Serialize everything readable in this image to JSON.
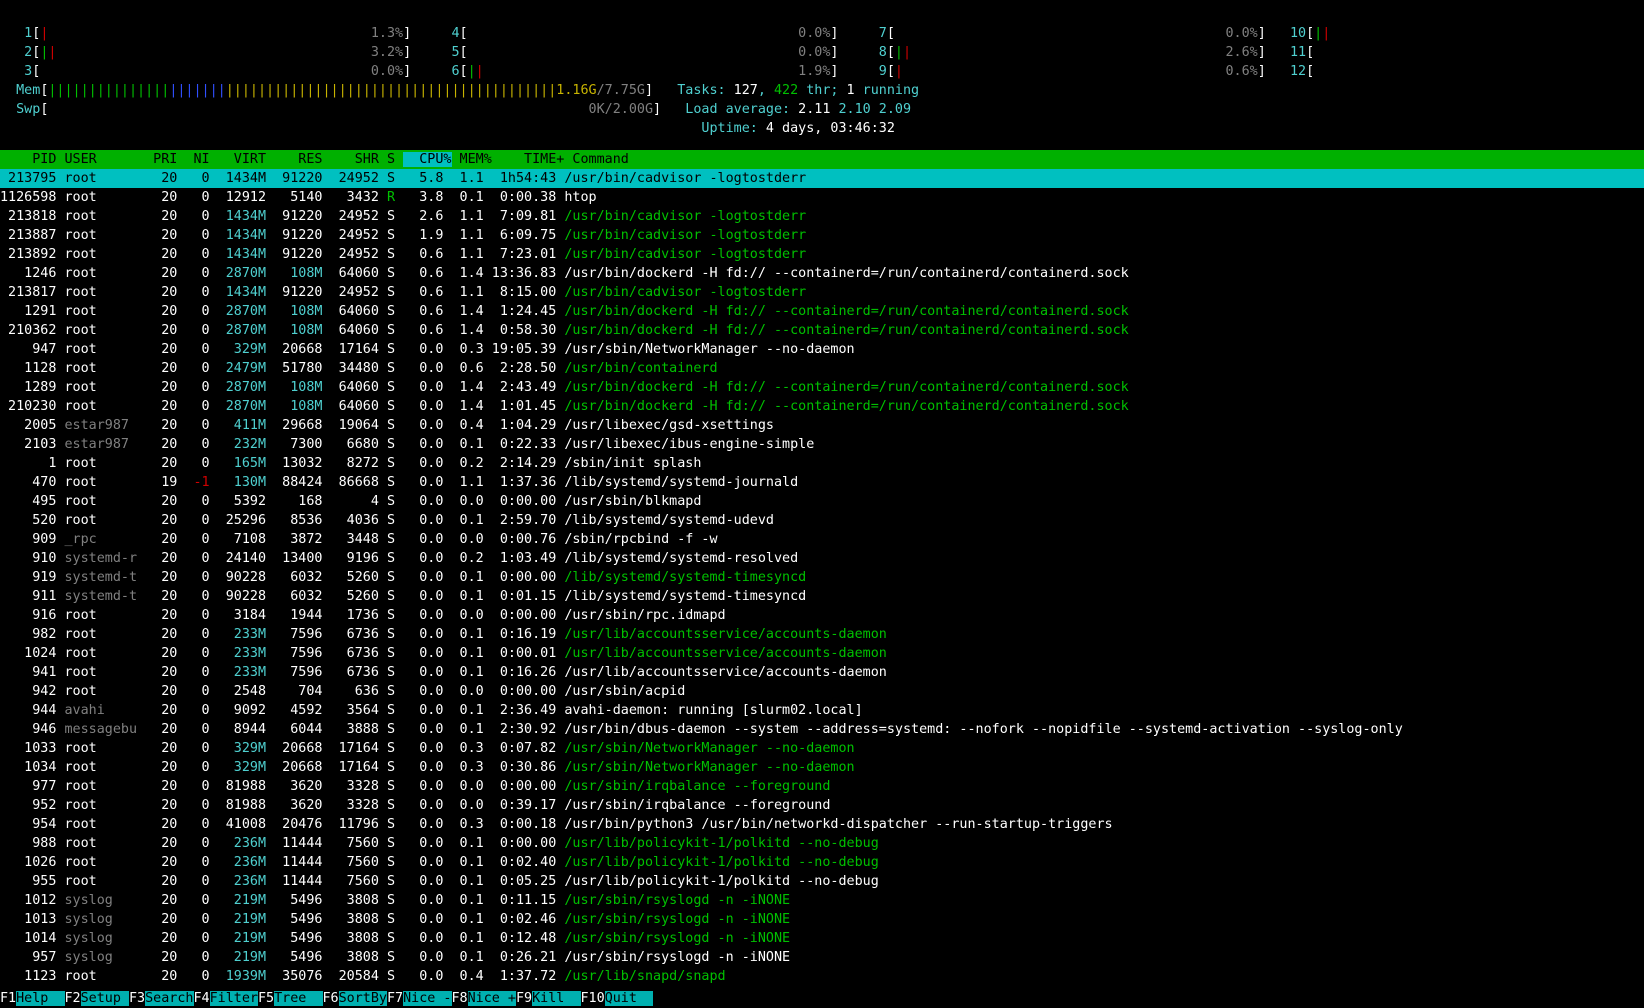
{
  "cpus": [
    {
      "id": "1",
      "pct": "1.3%"
    },
    {
      "id": "2",
      "pct": "3.2%"
    },
    {
      "id": "3",
      "pct": "0.0%"
    },
    {
      "id": "4",
      "pct": "0.0%"
    },
    {
      "id": "5",
      "pct": "0.0%"
    },
    {
      "id": "6",
      "pct": "1.9%"
    },
    {
      "id": "7",
      "pct": "0.0%"
    },
    {
      "id": "8",
      "pct": "2.6%"
    },
    {
      "id": "9",
      "pct": "0.6%"
    },
    {
      "id": "10",
      "pct": ""
    },
    {
      "id": "11",
      "pct": ""
    },
    {
      "id": "12",
      "pct": ""
    }
  ],
  "mem": {
    "label": "Mem",
    "used": "1.16G",
    "total": "7.75G"
  },
  "swp": {
    "label": "Swp",
    "used": "0K",
    "total": "2.00G"
  },
  "tasks": {
    "label": "Tasks:",
    "count": "127",
    "thr": "422",
    "thr_label": "thr;",
    "running": "1",
    "running_label": "running"
  },
  "load": {
    "label": "Load average:",
    "v1": "2.11",
    "v2": "2.10",
    "v3": "2.09"
  },
  "uptime": {
    "label": "Uptime:",
    "value": "4 days, 03:46:32"
  },
  "columns": [
    "PID",
    "USER",
    "PRI",
    "NI",
    "VIRT",
    "RES",
    "SHR",
    "S",
    "CPU%",
    "MEM%",
    "TIME+",
    "Command"
  ],
  "sorted_column": "CPU%",
  "processes": [
    {
      "pid": "213795",
      "user": "root",
      "pri": "20",
      "ni": "0",
      "virt": "1434M",
      "res": "91220",
      "shr": "24952",
      "s": "S",
      "cpu": "5.8",
      "mem": "1.1",
      "time": "1h54:43",
      "cmd": "/usr/bin/cadvisor -logtostderr",
      "thread": false,
      "selected": true
    },
    {
      "pid": "1126598",
      "user": "root",
      "pri": "20",
      "ni": "0",
      "virt": "12912",
      "res": "5140",
      "shr": "3432",
      "s": "R",
      "cpu": "3.8",
      "mem": "0.1",
      "time": "0:00.38",
      "cmd": "htop",
      "thread": false
    },
    {
      "pid": "213818",
      "user": "root",
      "pri": "20",
      "ni": "0",
      "virt": "1434M",
      "res": "91220",
      "shr": "24952",
      "s": "S",
      "cpu": "2.6",
      "mem": "1.1",
      "time": "7:09.81",
      "cmd": "/usr/bin/cadvisor -logtostderr",
      "thread": true
    },
    {
      "pid": "213887",
      "user": "root",
      "pri": "20",
      "ni": "0",
      "virt": "1434M",
      "res": "91220",
      "shr": "24952",
      "s": "S",
      "cpu": "1.9",
      "mem": "1.1",
      "time": "6:09.75",
      "cmd": "/usr/bin/cadvisor -logtostderr",
      "thread": true
    },
    {
      "pid": "213892",
      "user": "root",
      "pri": "20",
      "ni": "0",
      "virt": "1434M",
      "res": "91220",
      "shr": "24952",
      "s": "S",
      "cpu": "0.6",
      "mem": "1.1",
      "time": "7:23.01",
      "cmd": "/usr/bin/cadvisor -logtostderr",
      "thread": true
    },
    {
      "pid": "1246",
      "user": "root",
      "pri": "20",
      "ni": "0",
      "virt": "2870M",
      "res": "108M",
      "shr": "64060",
      "s": "S",
      "cpu": "0.6",
      "mem": "1.4",
      "time": "13:36.83",
      "cmd": "/usr/bin/dockerd -H fd:// --containerd=/run/containerd/containerd.sock",
      "thread": false
    },
    {
      "pid": "213817",
      "user": "root",
      "pri": "20",
      "ni": "0",
      "virt": "1434M",
      "res": "91220",
      "shr": "24952",
      "s": "S",
      "cpu": "0.6",
      "mem": "1.1",
      "time": "8:15.00",
      "cmd": "/usr/bin/cadvisor -logtostderr",
      "thread": true
    },
    {
      "pid": "1291",
      "user": "root",
      "pri": "20",
      "ni": "0",
      "virt": "2870M",
      "res": "108M",
      "shr": "64060",
      "s": "S",
      "cpu": "0.6",
      "mem": "1.4",
      "time": "1:24.45",
      "cmd": "/usr/bin/dockerd -H fd:// --containerd=/run/containerd/containerd.sock",
      "thread": true
    },
    {
      "pid": "210362",
      "user": "root",
      "pri": "20",
      "ni": "0",
      "virt": "2870M",
      "res": "108M",
      "shr": "64060",
      "s": "S",
      "cpu": "0.6",
      "mem": "1.4",
      "time": "0:58.30",
      "cmd": "/usr/bin/dockerd -H fd:// --containerd=/run/containerd/containerd.sock",
      "thread": true
    },
    {
      "pid": "947",
      "user": "root",
      "pri": "20",
      "ni": "0",
      "virt": "329M",
      "res": "20668",
      "shr": "17164",
      "s": "S",
      "cpu": "0.0",
      "mem": "0.3",
      "time": "19:05.39",
      "cmd": "/usr/sbin/NetworkManager --no-daemon",
      "thread": false
    },
    {
      "pid": "1128",
      "user": "root",
      "pri": "20",
      "ni": "0",
      "virt": "2479M",
      "res": "51780",
      "shr": "34480",
      "s": "S",
      "cpu": "0.0",
      "mem": "0.6",
      "time": "2:28.50",
      "cmd": "/usr/bin/containerd",
      "thread": true
    },
    {
      "pid": "1289",
      "user": "root",
      "pri": "20",
      "ni": "0",
      "virt": "2870M",
      "res": "108M",
      "shr": "64060",
      "s": "S",
      "cpu": "0.0",
      "mem": "1.4",
      "time": "2:43.49",
      "cmd": "/usr/bin/dockerd -H fd:// --containerd=/run/containerd/containerd.sock",
      "thread": true
    },
    {
      "pid": "210230",
      "user": "root",
      "pri": "20",
      "ni": "0",
      "virt": "2870M",
      "res": "108M",
      "shr": "64060",
      "s": "S",
      "cpu": "0.0",
      "mem": "1.4",
      "time": "1:01.45",
      "cmd": "/usr/bin/dockerd -H fd:// --containerd=/run/containerd/containerd.sock",
      "thread": true
    },
    {
      "pid": "2005",
      "user": "estar987",
      "pri": "20",
      "ni": "0",
      "virt": "411M",
      "res": "29668",
      "shr": "19064",
      "s": "S",
      "cpu": "0.0",
      "mem": "0.4",
      "time": "1:04.29",
      "cmd": "/usr/libexec/gsd-xsettings",
      "thread": false
    },
    {
      "pid": "2103",
      "user": "estar987",
      "pri": "20",
      "ni": "0",
      "virt": "232M",
      "res": "7300",
      "shr": "6680",
      "s": "S",
      "cpu": "0.0",
      "mem": "0.1",
      "time": "0:22.33",
      "cmd": "/usr/libexec/ibus-engine-simple",
      "thread": false
    },
    {
      "pid": "1",
      "user": "root",
      "pri": "20",
      "ni": "0",
      "virt": "165M",
      "res": "13032",
      "shr": "8272",
      "s": "S",
      "cpu": "0.0",
      "mem": "0.2",
      "time": "2:14.29",
      "cmd": "/sbin/init splash",
      "thread": false
    },
    {
      "pid": "470",
      "user": "root",
      "pri": "19",
      "ni": "-1",
      "virt": "130M",
      "res": "88424",
      "shr": "86668",
      "s": "S",
      "cpu": "0.0",
      "mem": "1.1",
      "time": "1:37.36",
      "cmd": "/lib/systemd/systemd-journald",
      "thread": false
    },
    {
      "pid": "495",
      "user": "root",
      "pri": "20",
      "ni": "0",
      "virt": "5392",
      "res": "168",
      "shr": "4",
      "s": "S",
      "cpu": "0.0",
      "mem": "0.0",
      "time": "0:00.00",
      "cmd": "/usr/sbin/blkmapd",
      "thread": false
    },
    {
      "pid": "520",
      "user": "root",
      "pri": "20",
      "ni": "0",
      "virt": "25296",
      "res": "8536",
      "shr": "4036",
      "s": "S",
      "cpu": "0.0",
      "mem": "0.1",
      "time": "2:59.70",
      "cmd": "/lib/systemd/systemd-udevd",
      "thread": false
    },
    {
      "pid": "909",
      "user": "_rpc",
      "pri": "20",
      "ni": "0",
      "virt": "7108",
      "res": "3872",
      "shr": "3448",
      "s": "S",
      "cpu": "0.0",
      "mem": "0.0",
      "time": "0:00.76",
      "cmd": "/sbin/rpcbind -f -w",
      "thread": false
    },
    {
      "pid": "910",
      "user": "systemd-r",
      "pri": "20",
      "ni": "0",
      "virt": "24140",
      "res": "13400",
      "shr": "9196",
      "s": "S",
      "cpu": "0.0",
      "mem": "0.2",
      "time": "1:03.49",
      "cmd": "/lib/systemd/systemd-resolved",
      "thread": false
    },
    {
      "pid": "919",
      "user": "systemd-t",
      "pri": "20",
      "ni": "0",
      "virt": "90228",
      "res": "6032",
      "shr": "5260",
      "s": "S",
      "cpu": "0.0",
      "mem": "0.1",
      "time": "0:00.00",
      "cmd": "/lib/systemd/systemd-timesyncd",
      "thread": true
    },
    {
      "pid": "911",
      "user": "systemd-t",
      "pri": "20",
      "ni": "0",
      "virt": "90228",
      "res": "6032",
      "shr": "5260",
      "s": "S",
      "cpu": "0.0",
      "mem": "0.1",
      "time": "0:01.15",
      "cmd": "/lib/systemd/systemd-timesyncd",
      "thread": false
    },
    {
      "pid": "916",
      "user": "root",
      "pri": "20",
      "ni": "0",
      "virt": "3184",
      "res": "1944",
      "shr": "1736",
      "s": "S",
      "cpu": "0.0",
      "mem": "0.0",
      "time": "0:00.00",
      "cmd": "/usr/sbin/rpc.idmapd",
      "thread": false
    },
    {
      "pid": "982",
      "user": "root",
      "pri": "20",
      "ni": "0",
      "virt": "233M",
      "res": "7596",
      "shr": "6736",
      "s": "S",
      "cpu": "0.0",
      "mem": "0.1",
      "time": "0:16.19",
      "cmd": "/usr/lib/accountsservice/accounts-daemon",
      "thread": true
    },
    {
      "pid": "1024",
      "user": "root",
      "pri": "20",
      "ni": "0",
      "virt": "233M",
      "res": "7596",
      "shr": "6736",
      "s": "S",
      "cpu": "0.0",
      "mem": "0.1",
      "time": "0:00.01",
      "cmd": "/usr/lib/accountsservice/accounts-daemon",
      "thread": true
    },
    {
      "pid": "941",
      "user": "root",
      "pri": "20",
      "ni": "0",
      "virt": "233M",
      "res": "7596",
      "shr": "6736",
      "s": "S",
      "cpu": "0.0",
      "mem": "0.1",
      "time": "0:16.26",
      "cmd": "/usr/lib/accountsservice/accounts-daemon",
      "thread": false
    },
    {
      "pid": "942",
      "user": "root",
      "pri": "20",
      "ni": "0",
      "virt": "2548",
      "res": "704",
      "shr": "636",
      "s": "S",
      "cpu": "0.0",
      "mem": "0.0",
      "time": "0:00.00",
      "cmd": "/usr/sbin/acpid",
      "thread": false
    },
    {
      "pid": "944",
      "user": "avahi",
      "pri": "20",
      "ni": "0",
      "virt": "9092",
      "res": "4592",
      "shr": "3564",
      "s": "S",
      "cpu": "0.0",
      "mem": "0.1",
      "time": "2:36.49",
      "cmd": "avahi-daemon: running [slurm02.local]",
      "thread": false
    },
    {
      "pid": "946",
      "user": "messagebu",
      "pri": "20",
      "ni": "0",
      "virt": "8944",
      "res": "6044",
      "shr": "3888",
      "s": "S",
      "cpu": "0.0",
      "mem": "0.1",
      "time": "2:30.92",
      "cmd": "/usr/bin/dbus-daemon --system --address=systemd: --nofork --nopidfile --systemd-activation --syslog-only",
      "thread": false
    },
    {
      "pid": "1033",
      "user": "root",
      "pri": "20",
      "ni": "0",
      "virt": "329M",
      "res": "20668",
      "shr": "17164",
      "s": "S",
      "cpu": "0.0",
      "mem": "0.3",
      "time": "0:07.82",
      "cmd": "/usr/sbin/NetworkManager --no-daemon",
      "thread": true
    },
    {
      "pid": "1034",
      "user": "root",
      "pri": "20",
      "ni": "0",
      "virt": "329M",
      "res": "20668",
      "shr": "17164",
      "s": "S",
      "cpu": "0.0",
      "mem": "0.3",
      "time": "0:30.86",
      "cmd": "/usr/sbin/NetworkManager --no-daemon",
      "thread": true
    },
    {
      "pid": "977",
      "user": "root",
      "pri": "20",
      "ni": "0",
      "virt": "81988",
      "res": "3620",
      "shr": "3328",
      "s": "S",
      "cpu": "0.0",
      "mem": "0.0",
      "time": "0:00.00",
      "cmd": "/usr/sbin/irqbalance --foreground",
      "thread": true
    },
    {
      "pid": "952",
      "user": "root",
      "pri": "20",
      "ni": "0",
      "virt": "81988",
      "res": "3620",
      "shr": "3328",
      "s": "S",
      "cpu": "0.0",
      "mem": "0.0",
      "time": "0:39.17",
      "cmd": "/usr/sbin/irqbalance --foreground",
      "thread": false
    },
    {
      "pid": "954",
      "user": "root",
      "pri": "20",
      "ni": "0",
      "virt": "41008",
      "res": "20476",
      "shr": "11796",
      "s": "S",
      "cpu": "0.0",
      "mem": "0.3",
      "time": "0:00.18",
      "cmd": "/usr/bin/python3 /usr/bin/networkd-dispatcher --run-startup-triggers",
      "thread": false
    },
    {
      "pid": "988",
      "user": "root",
      "pri": "20",
      "ni": "0",
      "virt": "236M",
      "res": "11444",
      "shr": "7560",
      "s": "S",
      "cpu": "0.0",
      "mem": "0.1",
      "time": "0:00.00",
      "cmd": "/usr/lib/policykit-1/polkitd --no-debug",
      "thread": true
    },
    {
      "pid": "1026",
      "user": "root",
      "pri": "20",
      "ni": "0",
      "virt": "236M",
      "res": "11444",
      "shr": "7560",
      "s": "S",
      "cpu": "0.0",
      "mem": "0.1",
      "time": "0:02.40",
      "cmd": "/usr/lib/policykit-1/polkitd --no-debug",
      "thread": true
    },
    {
      "pid": "955",
      "user": "root",
      "pri": "20",
      "ni": "0",
      "virt": "236M",
      "res": "11444",
      "shr": "7560",
      "s": "S",
      "cpu": "0.0",
      "mem": "0.1",
      "time": "0:05.25",
      "cmd": "/usr/lib/policykit-1/polkitd --no-debug",
      "thread": false
    },
    {
      "pid": "1012",
      "user": "syslog",
      "pri": "20",
      "ni": "0",
      "virt": "219M",
      "res": "5496",
      "shr": "3808",
      "s": "S",
      "cpu": "0.0",
      "mem": "0.1",
      "time": "0:11.15",
      "cmd": "/usr/sbin/rsyslogd -n -iNONE",
      "thread": true
    },
    {
      "pid": "1013",
      "user": "syslog",
      "pri": "20",
      "ni": "0",
      "virt": "219M",
      "res": "5496",
      "shr": "3808",
      "s": "S",
      "cpu": "0.0",
      "mem": "0.1",
      "time": "0:02.46",
      "cmd": "/usr/sbin/rsyslogd -n -iNONE",
      "thread": true
    },
    {
      "pid": "1014",
      "user": "syslog",
      "pri": "20",
      "ni": "0",
      "virt": "219M",
      "res": "5496",
      "shr": "3808",
      "s": "S",
      "cpu": "0.0",
      "mem": "0.1",
      "time": "0:12.48",
      "cmd": "/usr/sbin/rsyslogd -n -iNONE",
      "thread": true
    },
    {
      "pid": "957",
      "user": "syslog",
      "pri": "20",
      "ni": "0",
      "virt": "219M",
      "res": "5496",
      "shr": "3808",
      "s": "S",
      "cpu": "0.0",
      "mem": "0.1",
      "time": "0:26.21",
      "cmd": "/usr/sbin/rsyslogd -n -iNONE",
      "thread": false
    },
    {
      "pid": "1123",
      "user": "root",
      "pri": "20",
      "ni": "0",
      "virt": "1939M",
      "res": "35076",
      "shr": "20584",
      "s": "S",
      "cpu": "0.0",
      "mem": "0.4",
      "time": "1:37.72",
      "cmd": "/usr/lib/snapd/snapd",
      "thread": true
    }
  ],
  "footer": [
    {
      "key": "F1",
      "label": "Help  "
    },
    {
      "key": "F2",
      "label": "Setup "
    },
    {
      "key": "F3",
      "label": "Search"
    },
    {
      "key": "F4",
      "label": "Filter"
    },
    {
      "key": "F5",
      "label": "Tree  "
    },
    {
      "key": "F6",
      "label": "SortBy"
    },
    {
      "key": "F7",
      "label": "Nice -"
    },
    {
      "key": "F8",
      "label": "Nice +"
    },
    {
      "key": "F9",
      "label": "Kill  "
    },
    {
      "key": "F10",
      "label": "Quit  "
    }
  ]
}
